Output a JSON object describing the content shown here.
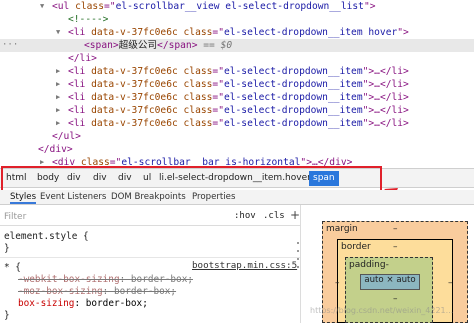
{
  "tree": {
    "lines": [
      {
        "pre": "<",
        "tag": "ul",
        "attrs": [
          {
            "n": "class",
            "v": "el-scrollbar__view el-select-dropdown__list"
          }
        ],
        "post": ">"
      },
      {
        "comment": "<!---->"
      },
      {
        "pre": "<",
        "tag": "li",
        "attrs": [
          {
            "n": "data-v-37fc0e6c",
            "v": ""
          },
          {
            "n": "class",
            "v": "el-select-dropdown__item hover"
          }
        ],
        "post": ">"
      },
      {
        "pre": "<",
        "tag": "span",
        "post": ">",
        "text": "超级公司",
        "close": "</span>",
        "tail": " == $0"
      },
      {
        "pre": "</",
        "tag": "li",
        "post": ">"
      },
      {
        "pre": "<",
        "tag": "li",
        "attrs": [
          {
            "n": "data-v-37fc0e6c",
            "v": ""
          },
          {
            "n": "class",
            "v": "el-select-dropdown__item"
          }
        ],
        "post": ">…</li>"
      },
      {
        "pre": "<",
        "tag": "li",
        "attrs": [
          {
            "n": "data-v-37fc0e6c",
            "v": ""
          },
          {
            "n": "class",
            "v": "el-select-dropdown__item"
          }
        ],
        "post": ">…</li>"
      },
      {
        "pre": "<",
        "tag": "li",
        "attrs": [
          {
            "n": "data-v-37fc0e6c",
            "v": ""
          },
          {
            "n": "class",
            "v": "el-select-dropdown__item"
          }
        ],
        "post": ">…</li>"
      },
      {
        "pre": "<",
        "tag": "li",
        "attrs": [
          {
            "n": "data-v-37fc0e6c",
            "v": ""
          },
          {
            "n": "class",
            "v": "el-select-dropdown__item"
          }
        ],
        "post": ">…</li>"
      },
      {
        "pre": "<",
        "tag": "li",
        "attrs": [
          {
            "n": "data-v-37fc0e6c",
            "v": ""
          },
          {
            "n": "class",
            "v": "el-select-dropdown__item"
          }
        ],
        "post": ">…</li>"
      },
      {
        "pre": "</",
        "tag": "ul",
        "post": ">"
      },
      {
        "pre": "</",
        "tag": "div",
        "post": ">"
      },
      {
        "pre": "<",
        "tag": "div",
        "attrs": [
          {
            "n": "class",
            "v": "el-scrollbar__bar is-horizontal"
          }
        ],
        "post": ">…</div>"
      }
    ]
  },
  "breadcrumb": {
    "items": [
      "html",
      "body",
      "div",
      "div",
      "div",
      "ul",
      "li.el-select-dropdown__item.hover",
      "span"
    ],
    "active_index": 7
  },
  "styles_tabs": {
    "items": [
      "Styles",
      "Event Listeners",
      "DOM Breakpoints",
      "Properties"
    ],
    "active": "Styles"
  },
  "filter": {
    "placeholder": "Filter",
    "hov": ":hov",
    "cls": ".cls",
    "plus": "+"
  },
  "rules": {
    "element_style_selector": "element.style {",
    "element_style_close": "}",
    "universal_selector": "* {",
    "universal_close": "}",
    "source": "bootstrap.min.css:5",
    "declarations": [
      {
        "prop": "-webkit-box-sizing",
        "value": "border-box;",
        "struck": true
      },
      {
        "prop": "-moz-box-sizing",
        "value": "border-box;",
        "struck": true
      },
      {
        "prop": "box-sizing",
        "value": "border-box;",
        "struck": false
      }
    ]
  },
  "boxmodel": {
    "margin_label": "margin",
    "margin_value": "–",
    "border_label": "border",
    "border_value": "–",
    "padding_label": "padding-",
    "padding_value": "–",
    "content": "auto × auto",
    "colors": {
      "margin": "#f9cc9d",
      "border": "#fddd9b",
      "padding": "#c3d08b",
      "content": "#8cb6c0"
    }
  },
  "watermark": "https://blog.csdn.net/weixin_4221..."
}
